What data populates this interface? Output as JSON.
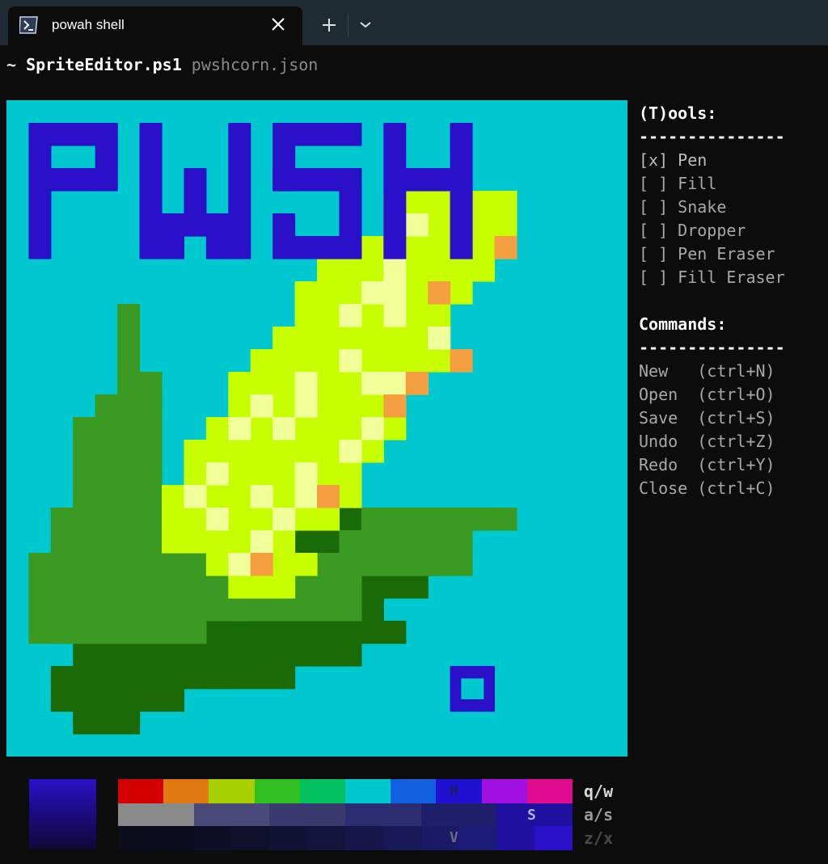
{
  "tab": {
    "title": "powah shell",
    "icon": "powershell-icon"
  },
  "prompt": {
    "tilde": "~",
    "command": "SpriteEditor.ps1",
    "argument": "pwshcorn.json"
  },
  "canvas": {
    "text": "PWSH",
    "cols": 28,
    "colors": {
      "background": "#00c8cf",
      "ink": "#2a10c8",
      "corn": "#c8ff00",
      "kernel": "#f0ff9a",
      "orange": "#f5a040",
      "leaf": "#3a9a22",
      "darkleaf": "#1a6a08"
    }
  },
  "tools": {
    "title": "(T)ools:",
    "rule": "---------------",
    "items": [
      {
        "check": "[x]",
        "label": "Pen"
      },
      {
        "check": "[ ]",
        "label": "Fill"
      },
      {
        "check": "[ ]",
        "label": "Snake"
      },
      {
        "check": "[ ]",
        "label": "Dropper"
      },
      {
        "check": "[ ]",
        "label": "Pen Eraser"
      },
      {
        "check": "[ ]",
        "label": "Fill Eraser"
      }
    ]
  },
  "commands": {
    "title": "Commands:",
    "rule": "---------------",
    "items": [
      {
        "label": "New  ",
        "shortcut": "(ctrl+N)"
      },
      {
        "label": "Open ",
        "shortcut": "(ctrl+O)"
      },
      {
        "label": "Save ",
        "shortcut": "(ctrl+S)"
      },
      {
        "label": "Undo ",
        "shortcut": "(ctrl+Z)"
      },
      {
        "label": "Redo ",
        "shortcut": "(ctrl+Y)"
      },
      {
        "label": "Close",
        "shortcut": "(ctrl+C)"
      }
    ]
  },
  "palette": {
    "selected_color": "#2a10c8",
    "hue_marker": "H",
    "sat_marker": "S",
    "val_marker": "V",
    "hue_keys": "q/w",
    "sat_keys": "a/s",
    "val_keys": "z/x",
    "hue_colors": [
      "#d40000",
      "#e07a10",
      "#a8d000",
      "#30c020",
      "#00c060",
      "#00c8cf",
      "#1060e0",
      "#2010d0",
      "#a010e0",
      "#e00a90"
    ],
    "sat_colors": [
      "#8a8a8a",
      "#8a8a8a",
      "#4a4a7a",
      "#4a4a7a",
      "#3a3a70",
      "#3a3a70",
      "#2c2c70",
      "#2c2c70",
      "#1e1e6a",
      "#1e1e6a",
      "#2010a0",
      "#2010a0"
    ],
    "val_colors": [
      "#0c0c1a",
      "#0c0c1e",
      "#0e0e24",
      "#10102c",
      "#121234",
      "#14143e",
      "#16164a",
      "#181858",
      "#1a1a66",
      "#1c1c78",
      "#2010a0",
      "#2a10c8"
    ]
  }
}
